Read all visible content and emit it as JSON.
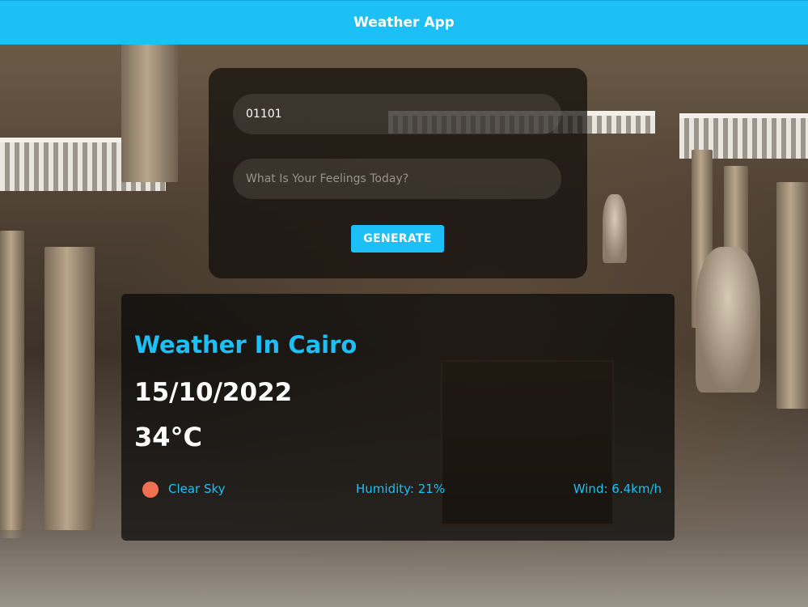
{
  "navbar": {
    "title": "Weather App"
  },
  "form": {
    "zip_value": "01101",
    "feelings_placeholder": "What Is Your Feelings Today?",
    "generate_label": "GENERATE"
  },
  "weather": {
    "city_line": "Weather In Cairo",
    "date": "15/10/2022",
    "temperature": "34°C",
    "condition": "Clear Sky",
    "condition_icon": "sun-icon",
    "humidity": "Humidity: 21%",
    "wind": "Wind: 6.4km/h"
  },
  "colors": {
    "accent": "#1cc0f6",
    "sun": "#f07152"
  }
}
